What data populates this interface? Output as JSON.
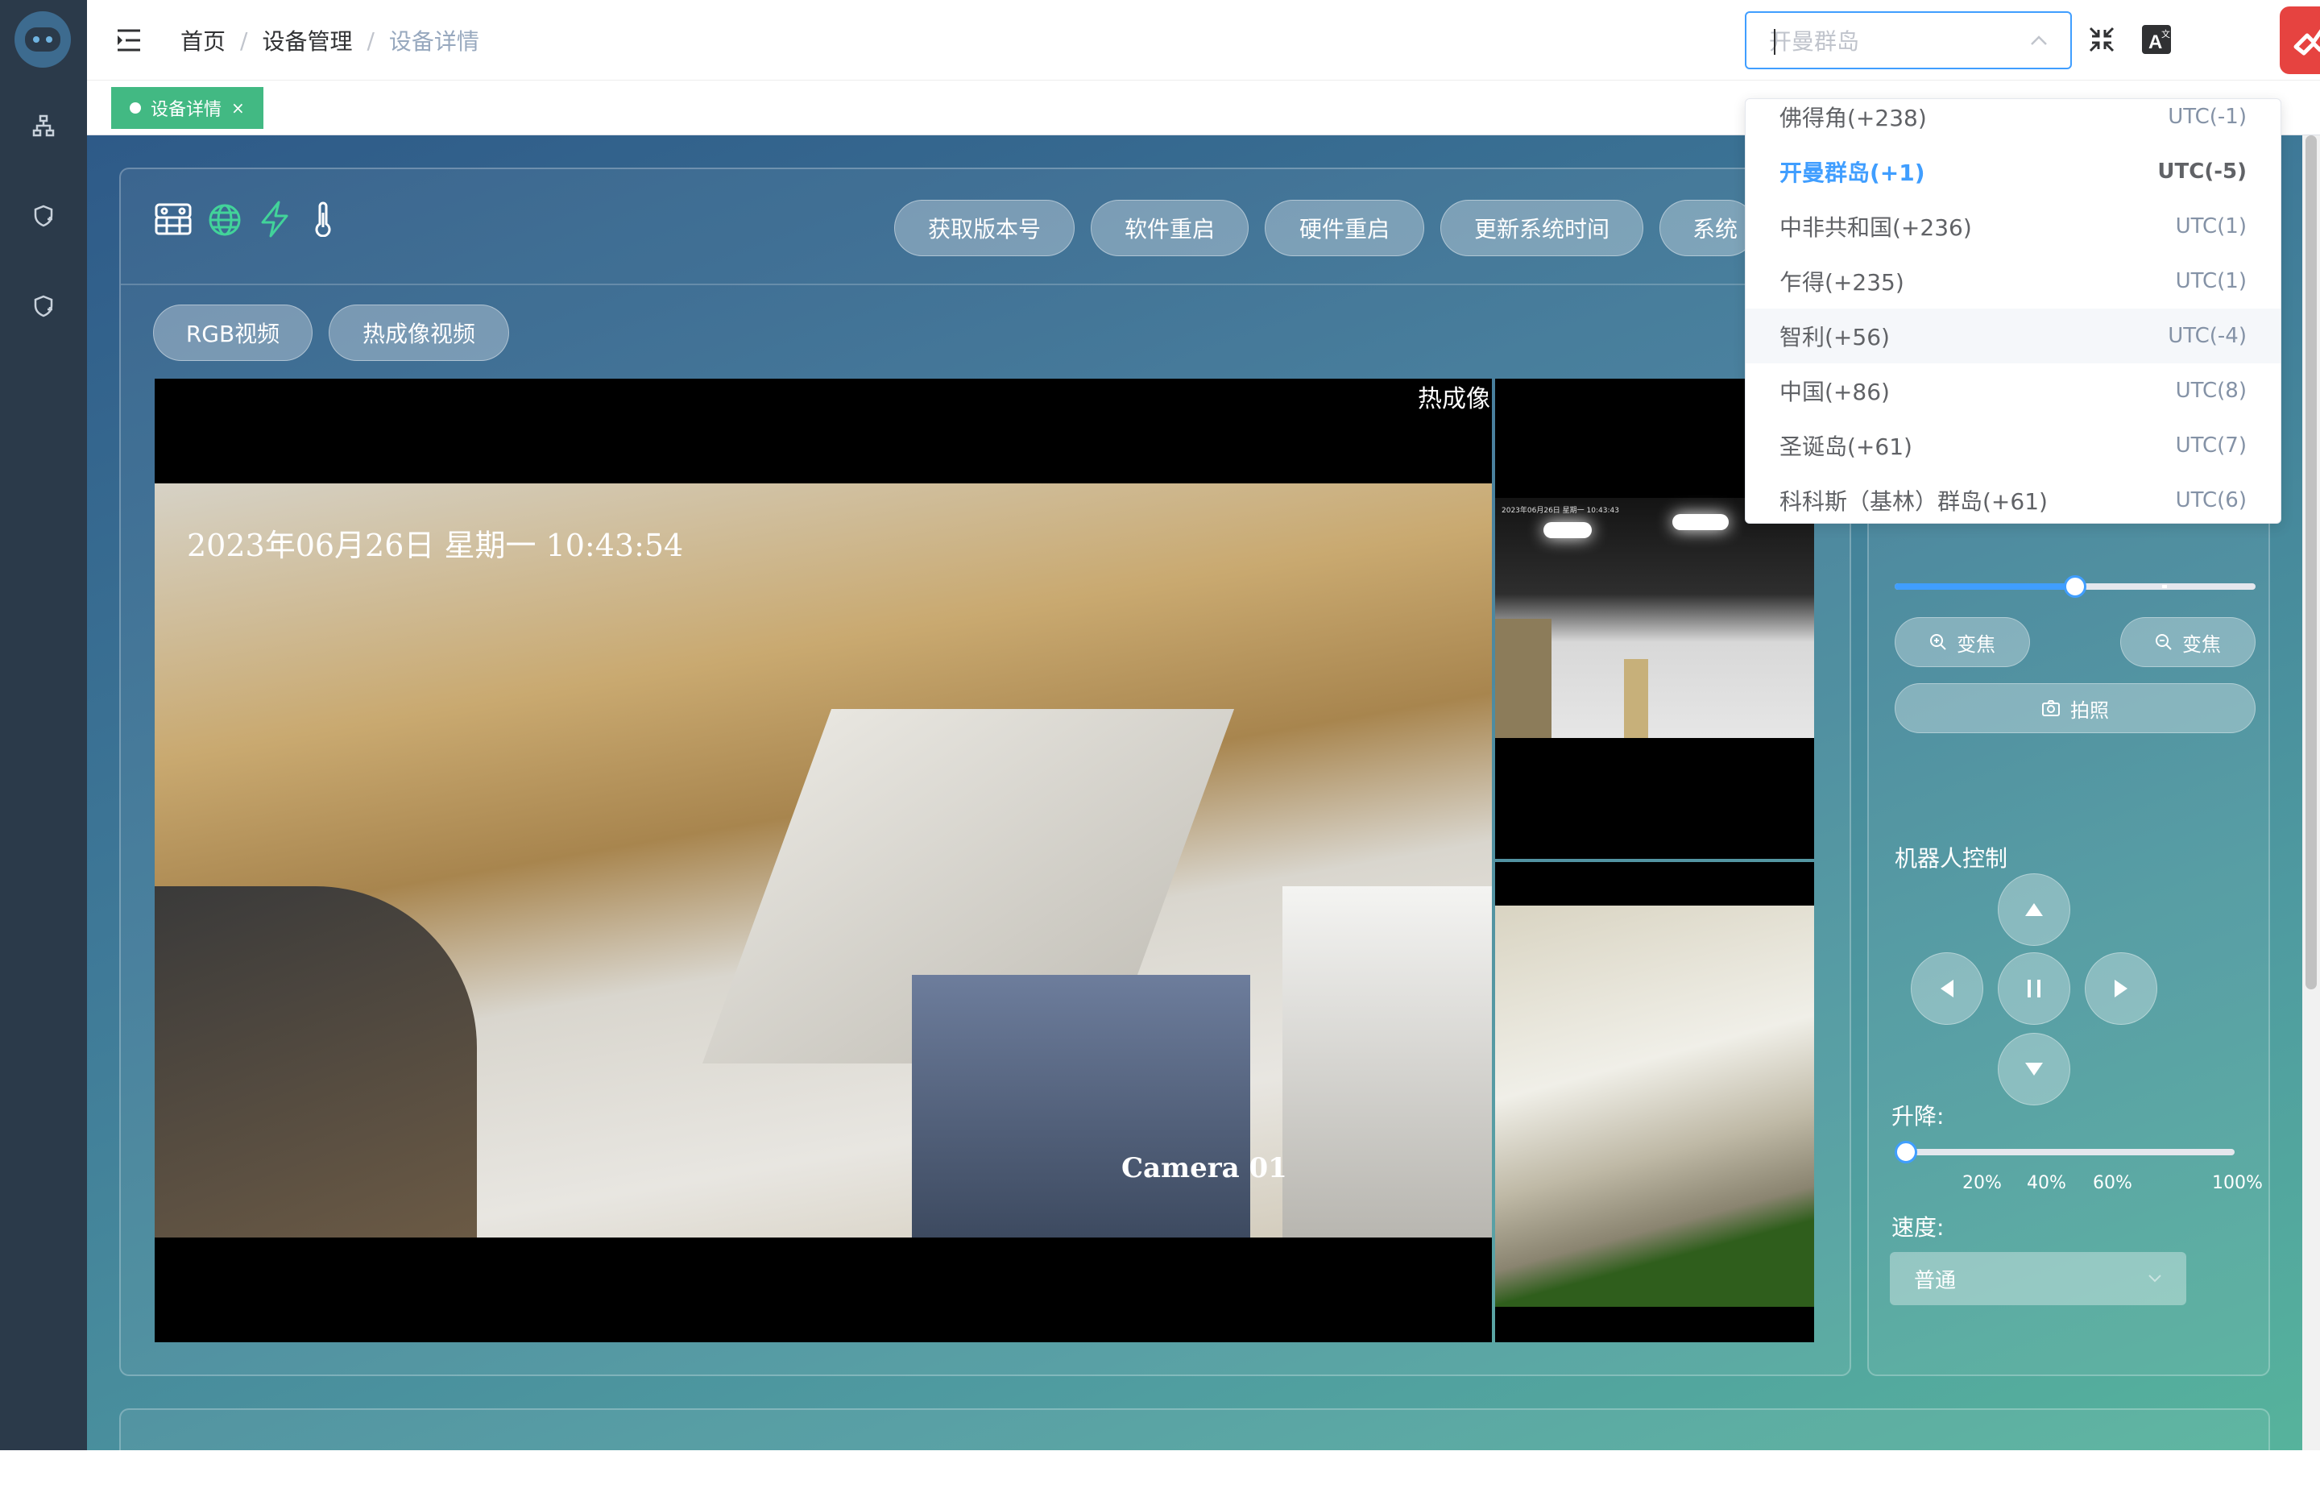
{
  "breadcrumb": {
    "home": "首页",
    "sep": "/",
    "device_mgmt": "设备管理",
    "current": "设备详情"
  },
  "tab": {
    "label": "设备详情",
    "close": "×"
  },
  "toolbar": {
    "get_version": "获取版本号",
    "soft_restart": "软件重启",
    "hard_restart": "硬件重启",
    "update_time": "更新系统时间",
    "system_partial": "系统"
  },
  "video_tabs": {
    "rgb": "RGB视频",
    "thermal": "热成像视频"
  },
  "video": {
    "thermal_label": "热成像",
    "timestamp": "2023年06月26日  星期一  10:43:54",
    "camera_label": "Camera 01",
    "thumb_timestamp": "2023年06月26日 星期一 10:43:43"
  },
  "ptz": {
    "zoom_level": 0.5,
    "zoom_in": "变焦",
    "zoom_out": "变焦",
    "photo": "拍照"
  },
  "robot": {
    "title": "机器人控制",
    "lift_label": "升降:",
    "lift_value": 0,
    "lift_marks": [
      "20%",
      "40%",
      "60%",
      "100%"
    ],
    "speed_label": "速度:",
    "speed_value": "普通"
  },
  "timezone": {
    "placeholder": "开曼群岛",
    "options": [
      {
        "name": "佛得角(+238)",
        "utc": "UTC(-1)"
      },
      {
        "name": "开曼群岛(+1)",
        "utc": "UTC(-5)"
      },
      {
        "name": "中非共和国(+236)",
        "utc": "UTC(1)"
      },
      {
        "name": "乍得(+235)",
        "utc": "UTC(1)"
      },
      {
        "name": "智利(+56)",
        "utc": "UTC(-4)"
      },
      {
        "name": "中国(+86)",
        "utc": "UTC(8)"
      },
      {
        "name": "圣诞岛(+61)",
        "utc": "UTC(7)"
      },
      {
        "name": "科科斯（基林）群岛(+61)",
        "utc": "UTC(6)"
      }
    ]
  },
  "colors": {
    "accent": "#409eff",
    "tag_green": "#42b983",
    "sidebar": "#2b3a4a",
    "avatar_red": "#e64340"
  },
  "icons": [
    "robot-logo-icon",
    "sitemap-icon",
    "shield-plus-icon",
    "hamburger-icon",
    "compress-icon",
    "translate-icon",
    "robot-device-icon",
    "globe-icon",
    "lightning-icon",
    "thermometer-icon"
  ]
}
